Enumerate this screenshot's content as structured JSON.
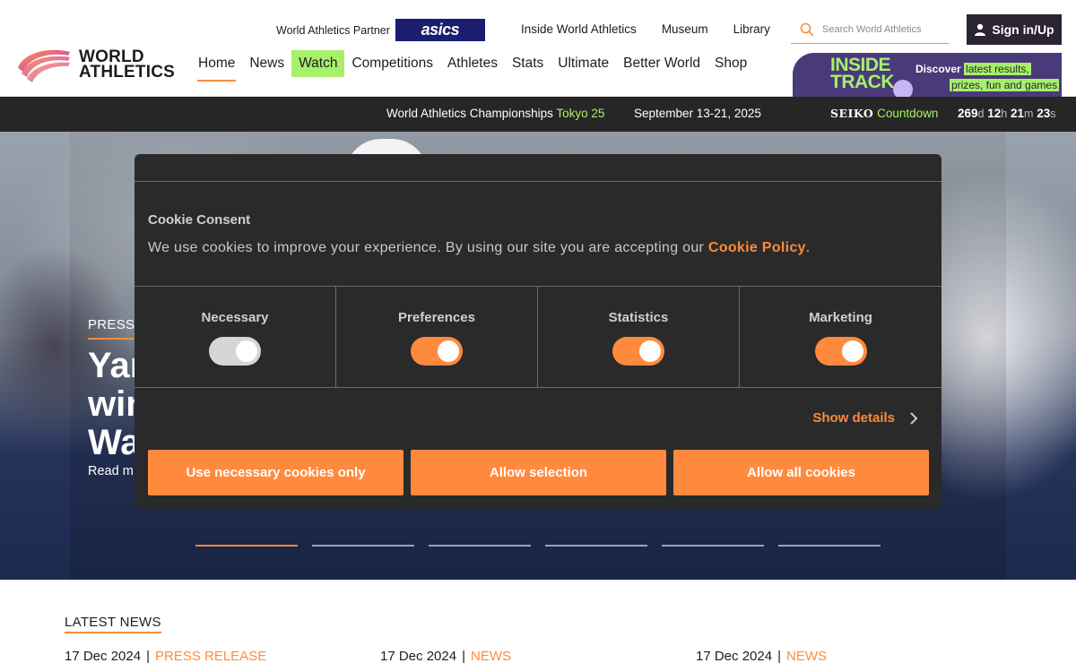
{
  "header": {
    "logo_line1": "WORLD",
    "logo_line2": "ATHLETICS",
    "partner_label": "World Athletics Partner",
    "partner_brand": "asics",
    "top_links": [
      "Inside World Athletics",
      "Museum",
      "Library"
    ],
    "search_placeholder": "Search World Athletics",
    "signin_label": "Sign in/Up",
    "nav": [
      "Home",
      "News",
      "Watch",
      "Competitions",
      "Athletes",
      "Stats",
      "Ultimate",
      "Better World",
      "Shop"
    ],
    "active_nav": "Home",
    "highlight_nav": "Watch",
    "promo": {
      "title_line1": "INSIDE",
      "title_line2": "TRACK",
      "discover": "Discover",
      "highlight1": "latest results,",
      "highlight2": "prizes, fun and games"
    }
  },
  "ticker": {
    "champ_prefix": "World Athletics Championships",
    "champ_city": "Tokyo 25",
    "dates": "September 13-21, 2025",
    "sponsor": "SEIKO",
    "countdown_label": "Countdown",
    "days": "269",
    "hours": "12",
    "minutes": "21",
    "seconds": "23",
    "d": "d",
    "h": "h",
    "m": "m",
    "s": "s"
  },
  "hero": {
    "label": "PRESS",
    "title_line1": "Yar",
    "title_line2": "win",
    "title_line3": "Wa",
    "read_more": "Read m",
    "slides": 6,
    "active_slide": 1
  },
  "cookie": {
    "title": "Cookie Consent",
    "body": "We use cookies to improve your experience. By using our site you are accepting our",
    "policy_link": "Cookie Policy",
    "period": ".",
    "categories": [
      {
        "label": "Necessary",
        "state": "disabled"
      },
      {
        "label": "Preferences",
        "state": "on"
      },
      {
        "label": "Statistics",
        "state": "on"
      },
      {
        "label": "Marketing",
        "state": "on"
      }
    ],
    "show_details": "Show details",
    "buttons": [
      "Use necessary cookies only",
      "Allow selection",
      "Allow all cookies"
    ]
  },
  "news": {
    "title": "LATEST NEWS",
    "items": [
      {
        "date": "17 Dec 2024",
        "category": "PRESS RELEASE"
      },
      {
        "date": "17 Dec 2024",
        "category": "NEWS"
      },
      {
        "date": "17 Dec 2024",
        "category": "NEWS"
      }
    ]
  },
  "colors": {
    "accent": "#ff8a3d",
    "green": "#a6f06a",
    "dark": "#262626",
    "asics_blue": "#1b1d6e",
    "promo_purple": "#4a3a7a"
  }
}
